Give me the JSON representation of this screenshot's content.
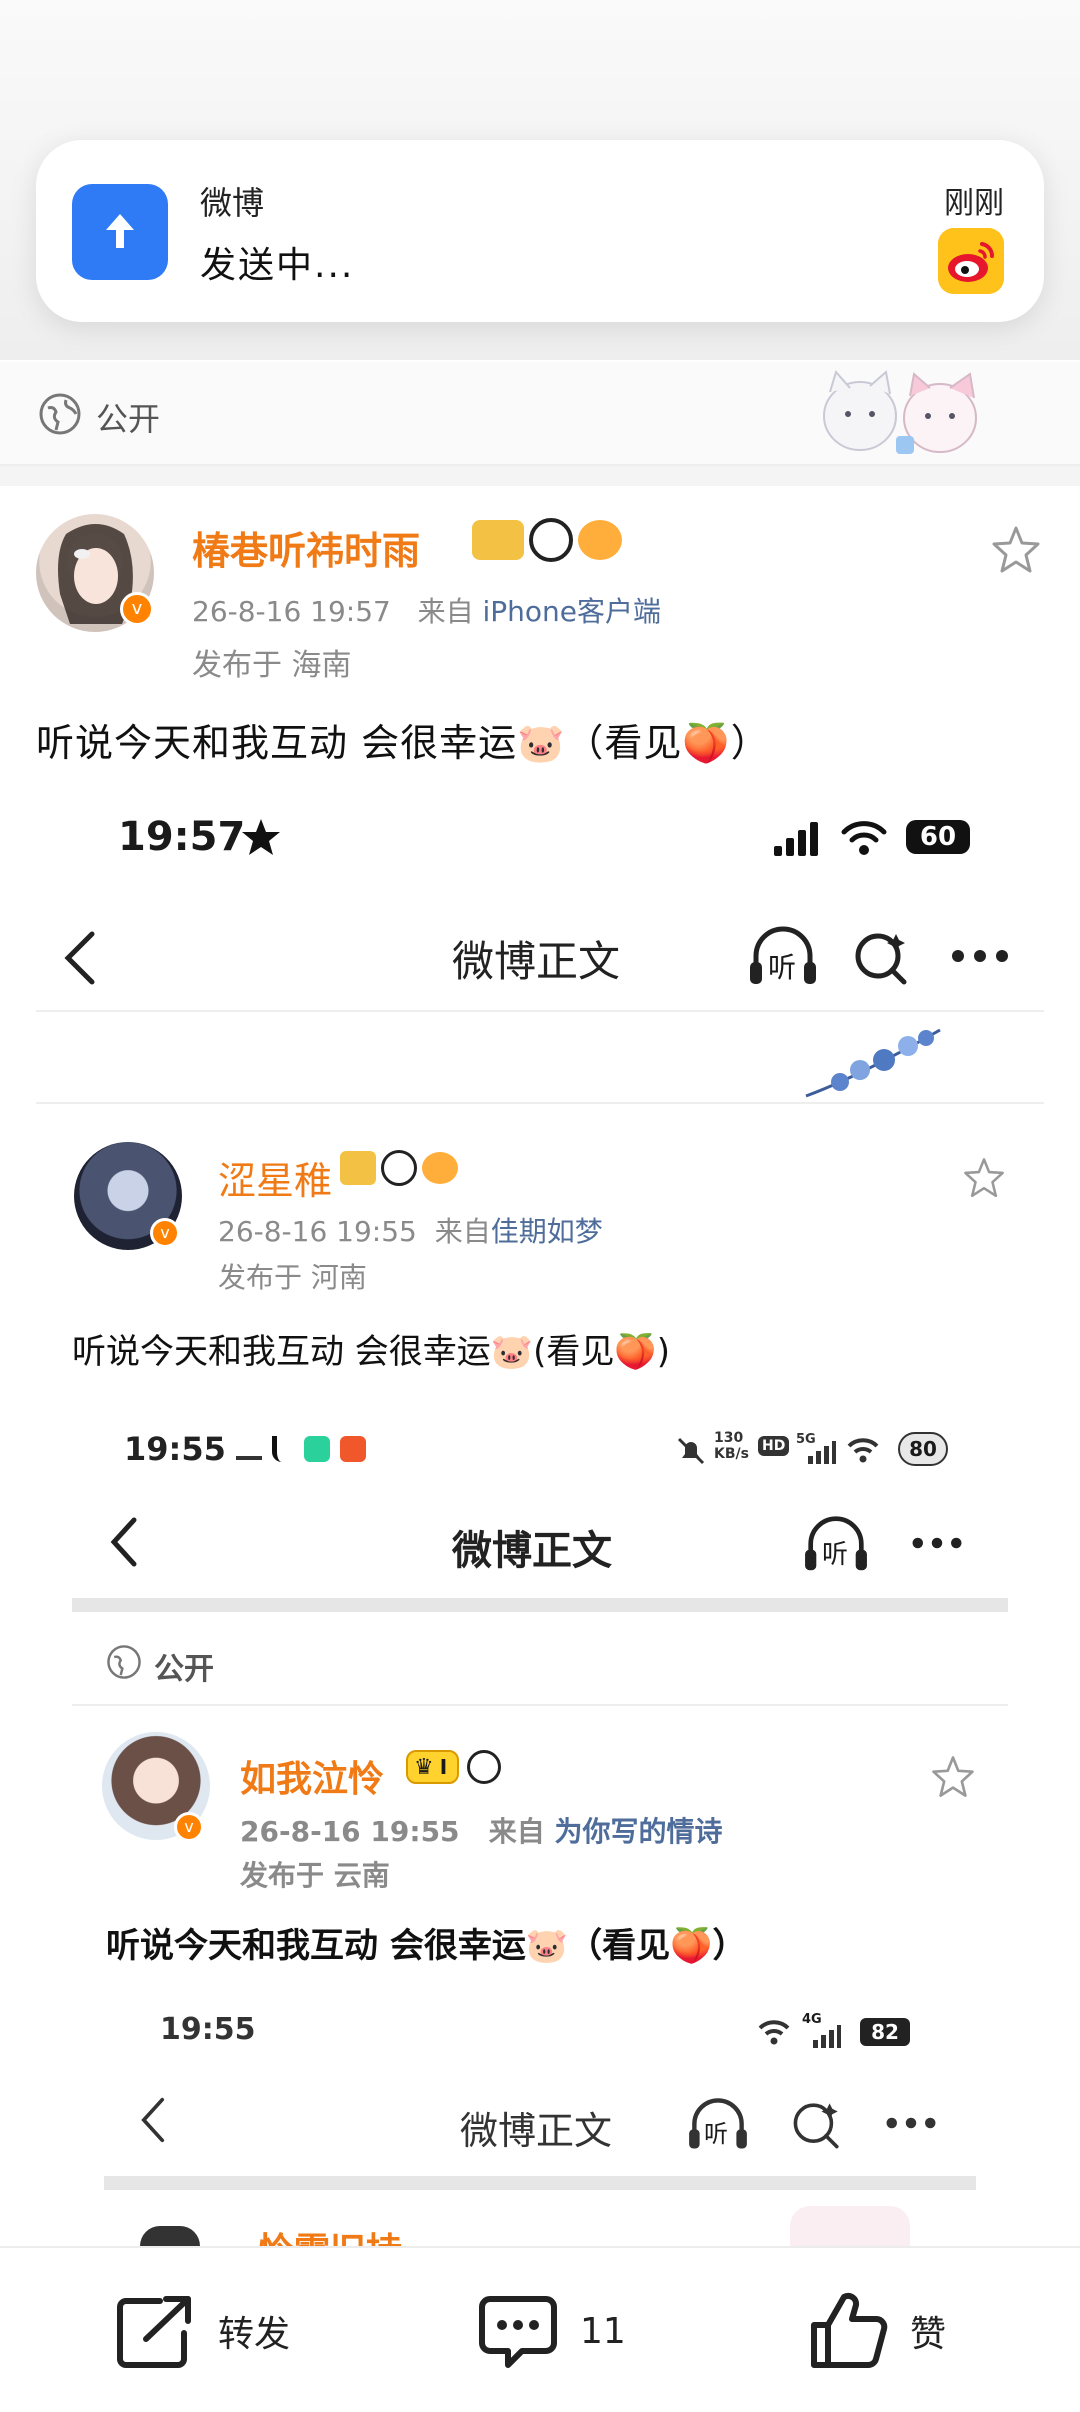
{
  "notification": {
    "app_name": "微博",
    "message": "发送中...",
    "time": "刚刚"
  },
  "visibility": {
    "label": "公开"
  },
  "post": {
    "username": "椿巷听祎时雨",
    "time": "26-8-16 19:57",
    "from_prefix": "来自",
    "source": "iPhone客户端",
    "location": "发布于 海南",
    "text": "听说今天和我互动 会很幸运🐷（看见🍑）"
  },
  "nested1": {
    "status_time": "19:57",
    "battery": "60",
    "title": "微博正文",
    "listen_label": "听",
    "post": {
      "username": "涩星稚",
      "time": "26-8-16 19:55",
      "from_prefix": "来自",
      "source": "佳期如梦",
      "location": "发布于 河南",
      "text": "听说今天和我互动 会很幸运🐷(看见🍑)"
    }
  },
  "nested2": {
    "status_time": "19:55",
    "net_speed": "130",
    "net_unit": "KB/s",
    "hd": "HD",
    "net_type": "5G",
    "battery": "80",
    "title": "微博正文",
    "listen_label": "听",
    "visibility": "公开",
    "post": {
      "username": "如我泣怜",
      "level": "I",
      "time": "26-8-16 19:55",
      "from_prefix": "来自",
      "source": "为你写的情诗",
      "location": "发布于 云南",
      "text": "听说今天和我互动 会很幸运🐷（看见🍑）"
    }
  },
  "nested3": {
    "status_time": "19:55",
    "net_type": "4G",
    "battery": "82",
    "title": "微博正文",
    "listen_label": "听",
    "partial_username": "怜霜旧持"
  },
  "bottom_bar": {
    "repost_label": "转发",
    "comment_count": "11",
    "like_label": "赞"
  },
  "colors": {
    "username": "#f07a15",
    "source_link": "#4f6d9b",
    "accent_blue": "#2f7bf6",
    "verified": "#ff8200"
  }
}
